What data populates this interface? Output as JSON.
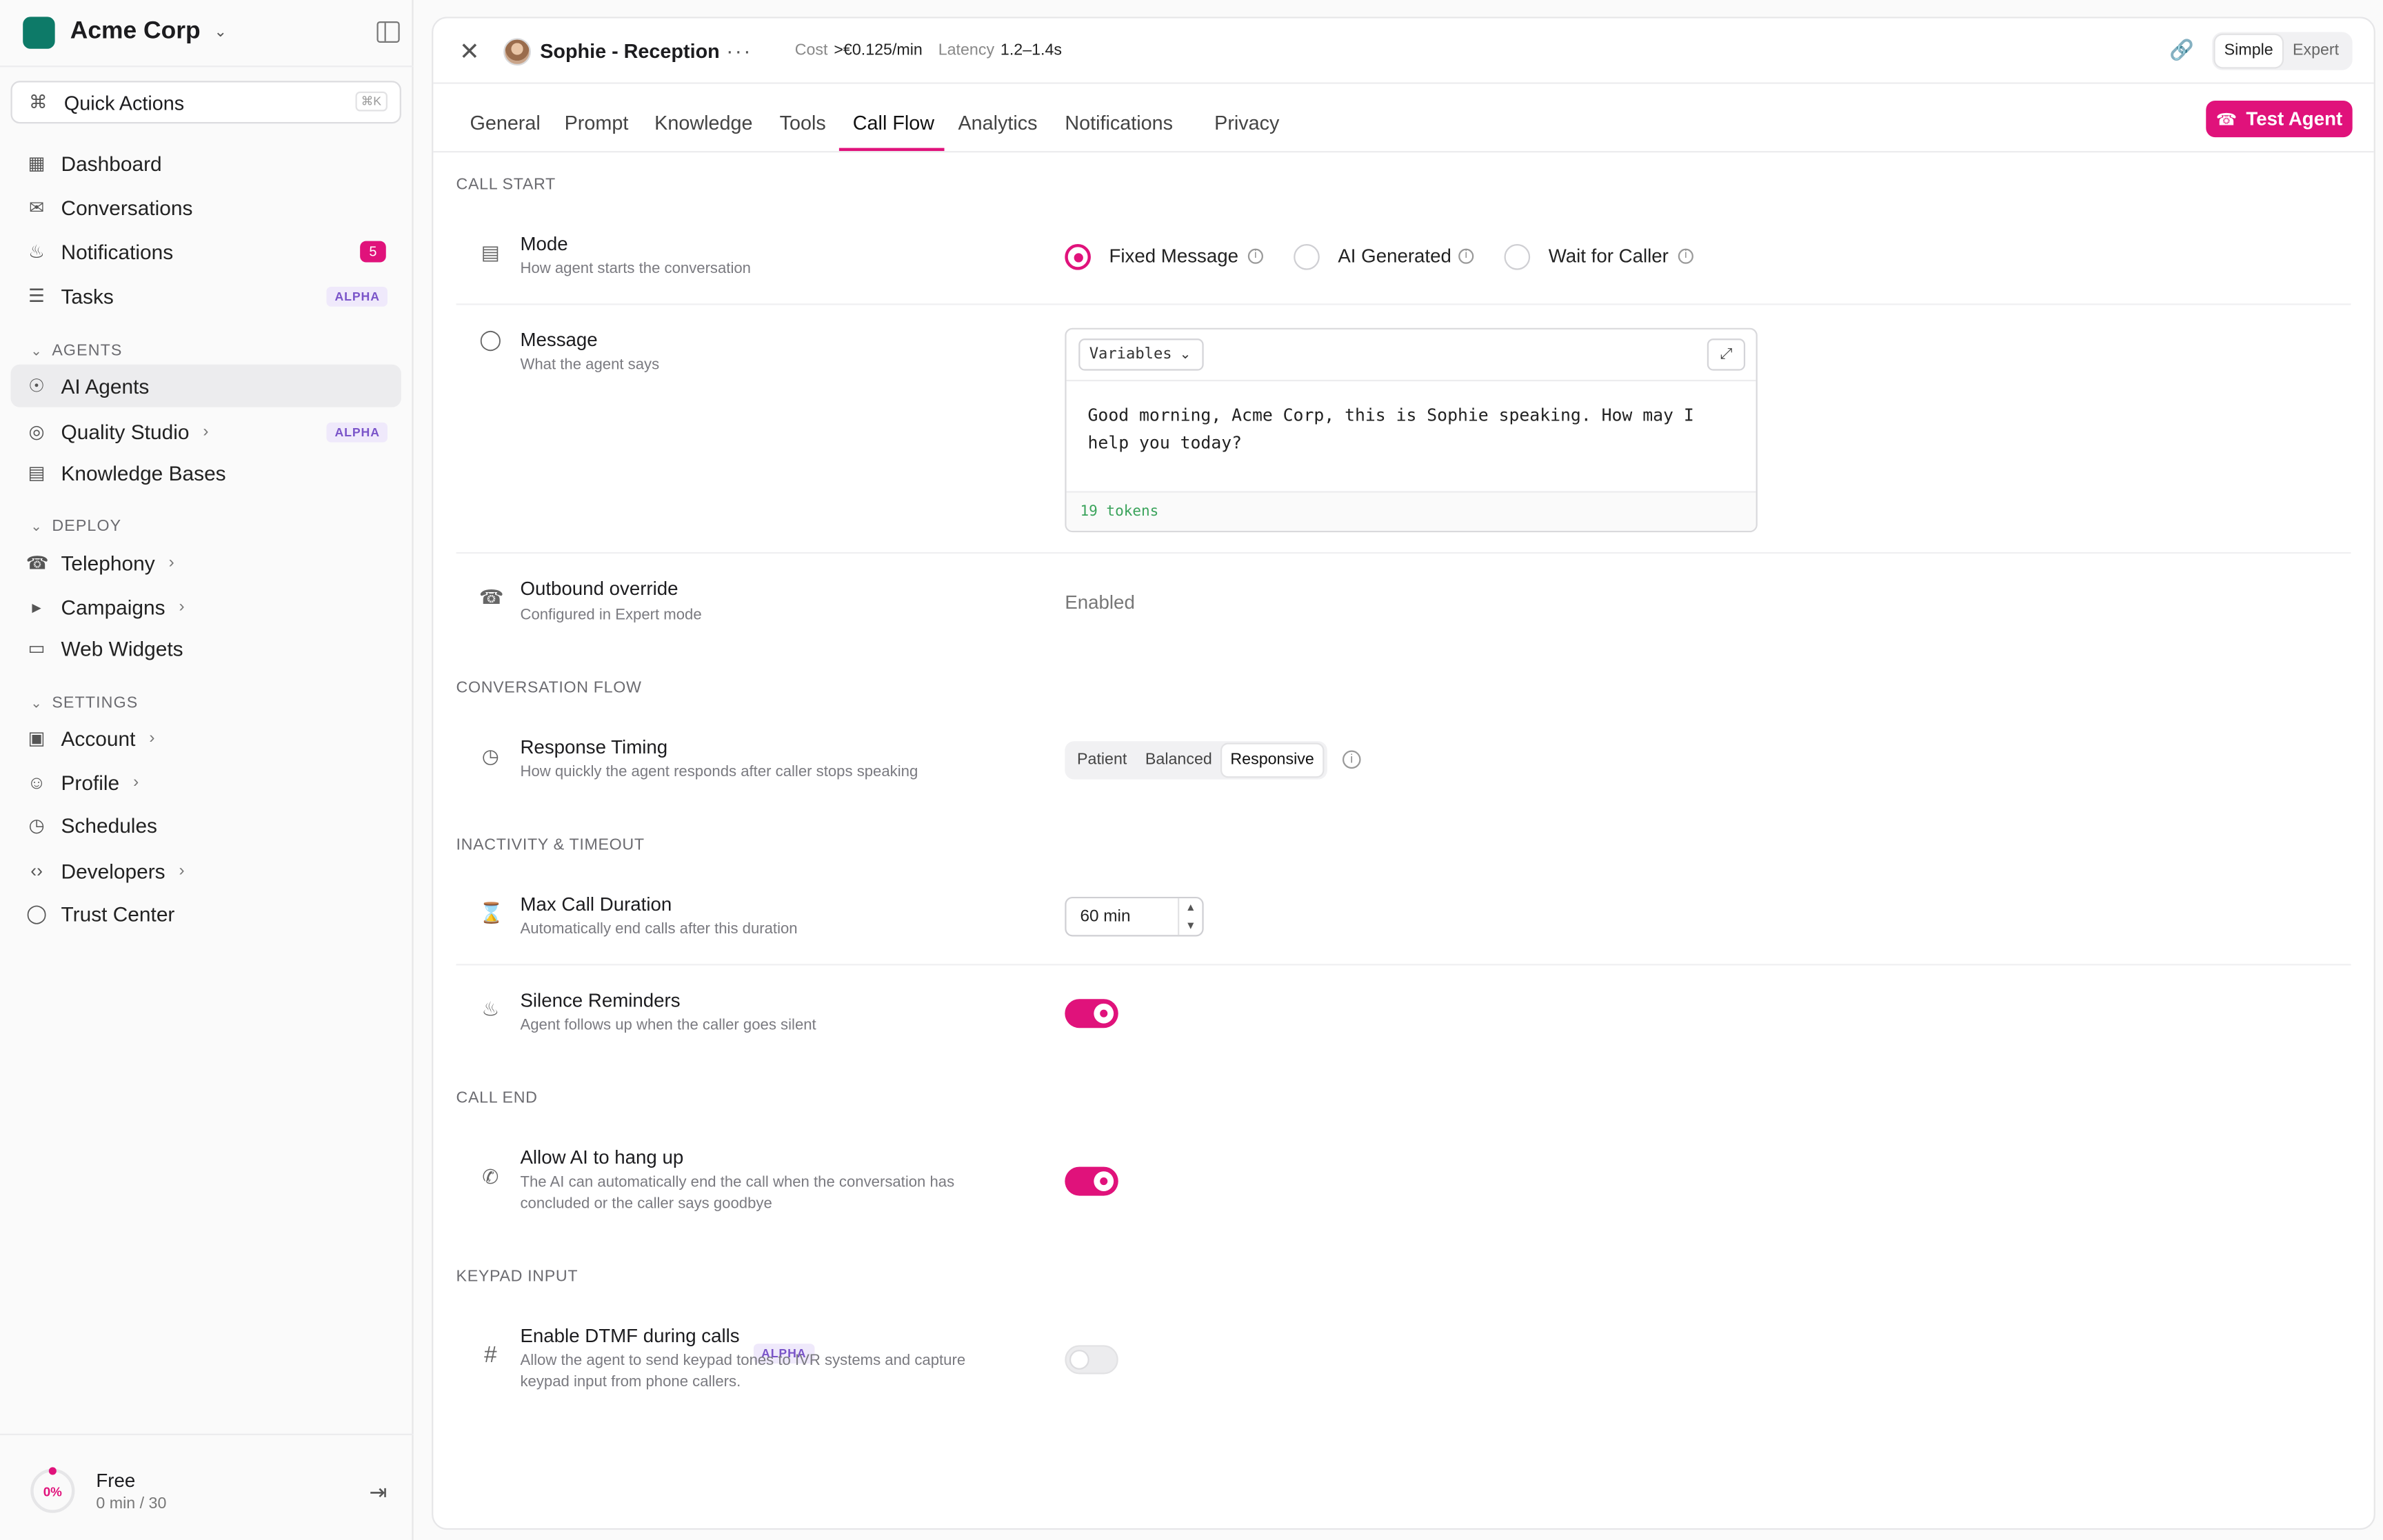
{
  "sidebar": {
    "org_name": "Acme Corp",
    "quick_actions": {
      "label": "Quick Actions",
      "shortcut": "⌘K"
    },
    "nav": [
      {
        "label": "Dashboard"
      },
      {
        "label": "Conversations"
      },
      {
        "label": "Notifications",
        "badge": "5"
      },
      {
        "label": "Tasks",
        "badge": "ALPHA"
      }
    ],
    "sections": {
      "agents": "AGENTS",
      "deploy": "DEPLOY",
      "settings": "SETTINGS"
    },
    "agents_items": [
      {
        "label": "AI Agents",
        "active": true
      },
      {
        "label": "Quality Studio",
        "badge": "ALPHA"
      },
      {
        "label": "Knowledge Bases"
      }
    ],
    "deploy_items": [
      {
        "label": "Telephony"
      },
      {
        "label": "Campaigns"
      },
      {
        "label": "Web Widgets"
      }
    ],
    "settings_items": [
      {
        "label": "Account"
      },
      {
        "label": "Profile"
      },
      {
        "label": "Schedules"
      },
      {
        "label": "Developers"
      },
      {
        "label": "Trust Center"
      }
    ],
    "usage": {
      "percent": "0%",
      "plan": "Free",
      "minutes": "0 min / 30"
    }
  },
  "header": {
    "agent_name": "Sophie - Reception",
    "cost_label": "Cost",
    "cost_value": ">€0.125/min",
    "latency_label": "Latency",
    "latency_value": "1.2–1.4s",
    "mode_options": [
      "Simple",
      "Expert"
    ],
    "mode_selected": "Simple"
  },
  "tabs": [
    "General",
    "Prompt",
    "Knowledge",
    "Tools",
    "Call Flow",
    "Analytics",
    "Notifications",
    "Privacy"
  ],
  "active_tab": "Call Flow",
  "test_button": "Test Agent",
  "call_start": {
    "heading": "CALL START",
    "mode": {
      "title": "Mode",
      "subtitle": "How agent starts the conversation",
      "options": [
        "Fixed Message",
        "AI Generated",
        "Wait for Caller"
      ],
      "selected": "Fixed Message"
    },
    "message": {
      "title": "Message",
      "subtitle": "What the agent says",
      "variables_label": "Variables",
      "text": "Good morning, Acme Corp, this is Sophie speaking. How may I help you today?",
      "tokens": "19 tokens"
    },
    "outbound": {
      "title": "Outbound override",
      "subtitle": "Configured in Expert mode",
      "value": "Enabled"
    }
  },
  "conversation_flow": {
    "heading": "CONVERSATION FLOW",
    "timing": {
      "title": "Response Timing",
      "subtitle": "How quickly the agent responds after caller stops speaking",
      "options": [
        "Patient",
        "Balanced",
        "Responsive"
      ],
      "selected": "Responsive"
    }
  },
  "inactivity": {
    "heading": "INACTIVITY & TIMEOUT",
    "max_duration": {
      "title": "Max Call Duration",
      "subtitle": "Automatically end calls after this duration",
      "value": "60 min"
    },
    "silence": {
      "title": "Silence Reminders",
      "subtitle": "Agent follows up when the caller goes silent",
      "enabled": true
    }
  },
  "call_end": {
    "heading": "CALL END",
    "hang_up": {
      "title": "Allow AI to hang up",
      "subtitle": "The AI can automatically end the call when the conversation has concluded or the caller says goodbye",
      "enabled": true
    }
  },
  "keypad": {
    "heading": "KEYPAD INPUT",
    "dtmf": {
      "title": "Enable DTMF during calls",
      "badge": "ALPHA",
      "subtitle": "Allow the agent to send keypad tones to IVR systems and capture keypad input from phone callers.",
      "enabled": false
    }
  },
  "colors": {
    "accent": "#e0127b",
    "brand": "#0d7a68",
    "alpha_badge": "#7a54c9"
  }
}
